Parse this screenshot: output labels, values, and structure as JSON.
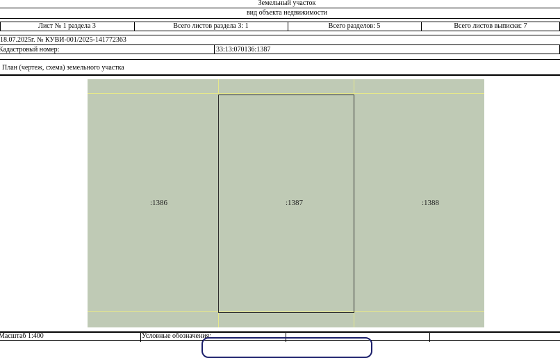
{
  "header": {
    "object_type": "Земельный участок",
    "object_type_caption": "вид объекта недвижимости"
  },
  "sheet_row": {
    "sheet": "Лист № 1 раздела 3",
    "sheets_in_section": "Всего листов раздела 3: 1",
    "sections_total": "Всего разделов: 5",
    "sheets_total": "Всего листов выписки: 7"
  },
  "document_ref": "18.07.2025г. № КУВИ-001/2025-141772363",
  "cadastral": {
    "label": "Кадастровый номер:",
    "value": "33:13:070136:1387"
  },
  "plan_title": "План (чертеж, схема) земельного участка",
  "parcels": [
    ":1386",
    ":1387",
    ":1388"
  ],
  "footer": {
    "scale": "Масштаб 1:400",
    "legend_label": "Условные обозначения:"
  },
  "colors": {
    "plan_fill": "#bfcab5",
    "grid_lines": "#e6e88a",
    "parcel_border": "#2e2e2e",
    "legend_border": "#1b1f6b"
  }
}
